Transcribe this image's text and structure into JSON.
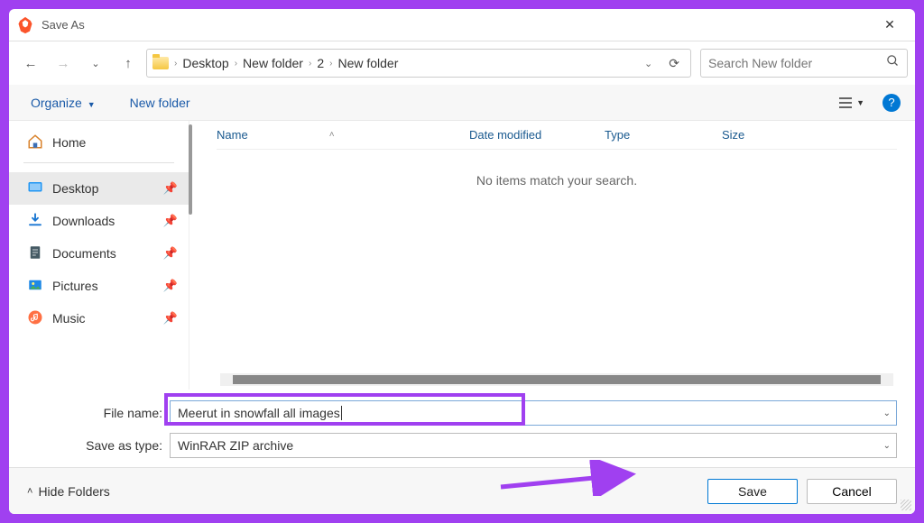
{
  "title": "Save As",
  "breadcrumbs": [
    "Desktop",
    "New folder",
    "2",
    "New folder"
  ],
  "search_placeholder": "Search New folder",
  "toolbar": {
    "organize": "Organize",
    "newfolder": "New folder"
  },
  "sidebar": {
    "home": "Home",
    "items": [
      {
        "label": "Desktop",
        "active": true
      },
      {
        "label": "Downloads",
        "active": false
      },
      {
        "label": "Documents",
        "active": false
      },
      {
        "label": "Pictures",
        "active": false
      },
      {
        "label": "Music",
        "active": false
      }
    ]
  },
  "columns": {
    "name": "Name",
    "date": "Date modified",
    "type": "Type",
    "size": "Size"
  },
  "empty_text": "No items match your search.",
  "filename_label": "File name:",
  "filename_value": "Meerut in snowfall all images",
  "savetype_label": "Save as type:",
  "savetype_value": "WinRAR ZIP archive",
  "footer": {
    "hide": "Hide Folders",
    "save": "Save",
    "cancel": "Cancel"
  }
}
